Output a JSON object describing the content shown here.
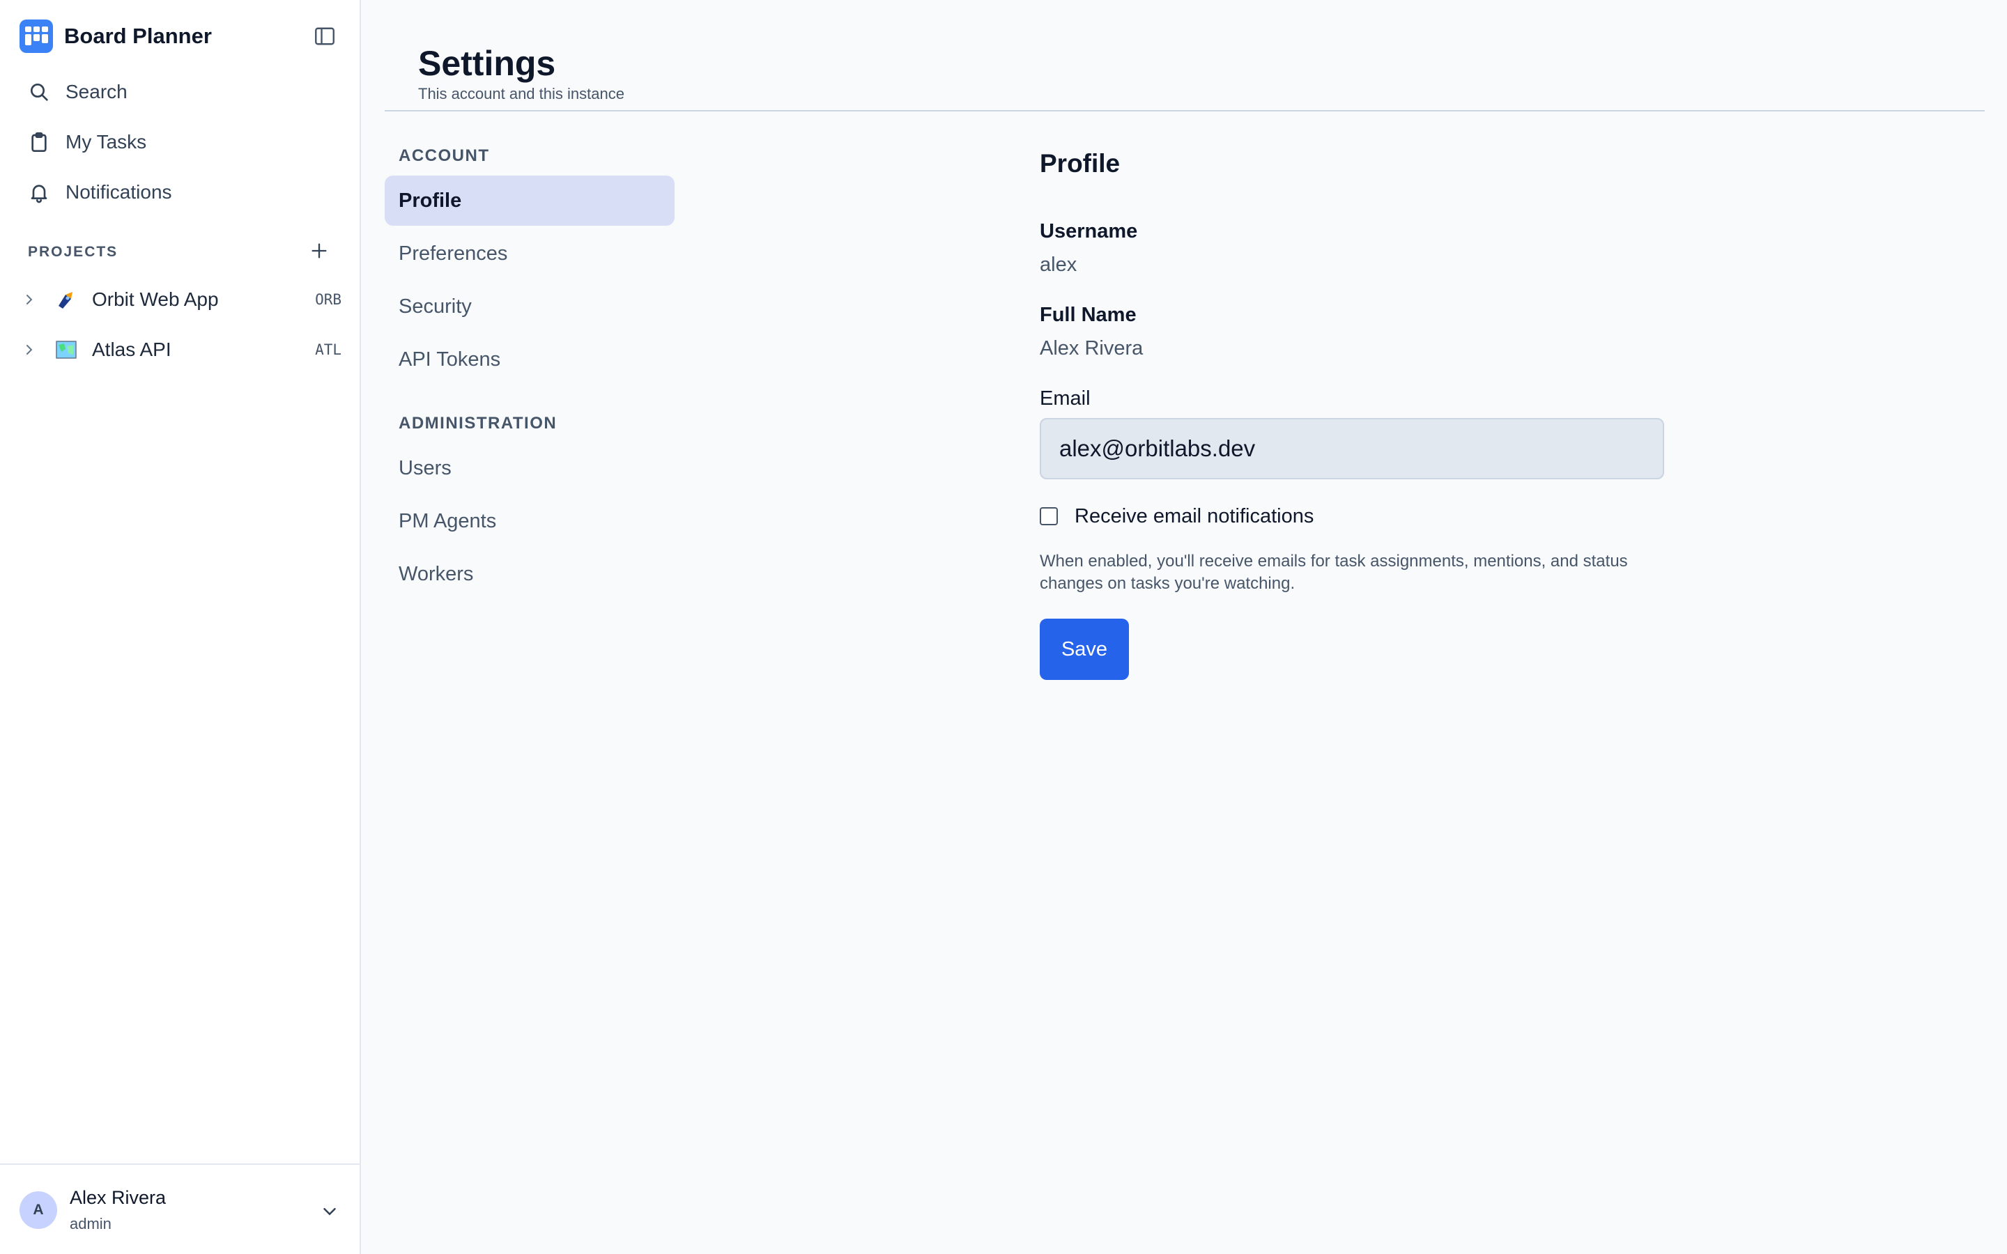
{
  "app": {
    "name": "Board Planner",
    "accent_color": "#3b82f6"
  },
  "sidebar": {
    "nav": [
      {
        "label": "Search",
        "icon": "search-icon"
      },
      {
        "label": "My Tasks",
        "icon": "clipboard-icon"
      },
      {
        "label": "Notifications",
        "icon": "bell-icon"
      }
    ],
    "projects_label": "PROJECTS",
    "projects": [
      {
        "name": "Orbit Web App",
        "key": "ORB",
        "icon": "rocket-emoji-icon"
      },
      {
        "name": "Atlas API",
        "key": "ATL",
        "icon": "map-emoji-icon"
      }
    ],
    "user": {
      "initial": "A",
      "name": "Alex Rivera",
      "role": "admin"
    }
  },
  "header": {
    "title": "Settings",
    "subtitle": "This account and this instance"
  },
  "settings_nav": {
    "account_label": "ACCOUNT",
    "account_items": [
      "Profile",
      "Preferences",
      "Security",
      "API Tokens"
    ],
    "admin_label": "ADMINISTRATION",
    "admin_items": [
      "Users",
      "PM Agents",
      "Workers"
    ],
    "active": "Profile"
  },
  "profile": {
    "title": "Profile",
    "username_label": "Username",
    "username": "alex",
    "fullname_label": "Full Name",
    "fullname": "Alex Rivera",
    "email_label": "Email",
    "email": "alex@orbitlabs.dev",
    "notify_label": "Receive email notifications",
    "notify_checked": false,
    "help_text": "When enabled, you'll receive emails for task assignments, mentions, and status changes on tasks you're watching.",
    "save_label": "Save"
  }
}
